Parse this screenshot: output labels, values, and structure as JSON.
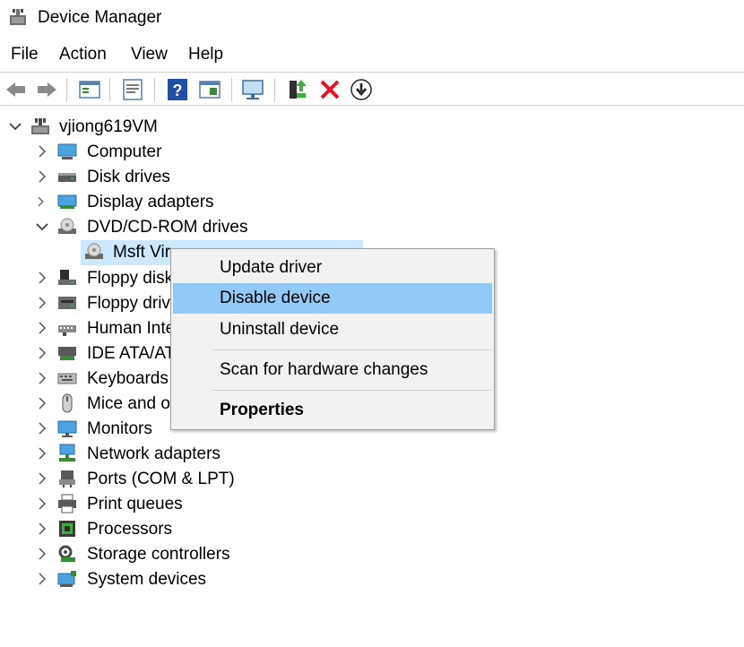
{
  "window": {
    "title": "Device Manager",
    "icon": "device-manager-icon"
  },
  "menu": [
    "File",
    "Action",
    "View",
    "Help"
  ],
  "toolbar": [
    "back-arrow-icon",
    "forward-arrow-icon",
    "show-hide-tree-icon",
    "properties-sheet-icon",
    "help-icon",
    "update-driver-view-icon",
    "monitor-scan-icon",
    "update-driver-icon",
    "uninstall-x-icon",
    "download-arrow-icon"
  ],
  "tree": {
    "root": {
      "label": "vjiong619VM",
      "expanded": true
    },
    "categories": [
      {
        "label": "Computer",
        "icon": "computer-icon"
      },
      {
        "label": "Disk drives",
        "icon": "disk-drive-icon"
      },
      {
        "label": "Display adapters",
        "icon": "display-adapter-icon"
      },
      {
        "label": "DVD/CD-ROM drives",
        "icon": "dvd-drive-icon",
        "expanded": true
      },
      {
        "label": "Floppy disk",
        "icon": "floppy-disk-icon"
      },
      {
        "label": "Floppy driv",
        "icon": "floppy-drive-icon"
      },
      {
        "label": "Human Inte",
        "icon": "human-interface-icon"
      },
      {
        "label": "IDE ATA/AT",
        "icon": "ide-ata-icon"
      },
      {
        "label": "Keyboards",
        "icon": "keyboard-icon"
      },
      {
        "label": "Mice and o",
        "icon": "mouse-icon"
      },
      {
        "label": "Monitors",
        "icon": "monitor-icon"
      },
      {
        "label": "Network adapters",
        "icon": "network-adapter-icon"
      },
      {
        "label": "Ports (COM & LPT)",
        "icon": "port-icon"
      },
      {
        "label": "Print queues",
        "icon": "printer-icon"
      },
      {
        "label": "Processors",
        "icon": "processor-icon"
      },
      {
        "label": "Storage controllers",
        "icon": "storage-controller-icon"
      },
      {
        "label": "System devices",
        "icon": "system-devices-icon"
      }
    ],
    "selected_device": {
      "label": "Msft Vir",
      "icon": "dvd-device-icon"
    }
  },
  "context_menu": {
    "items": [
      "Update driver",
      "Disable device",
      "Uninstall device",
      "Scan for hardware changes",
      "Properties"
    ],
    "highlighted": "Disable device"
  },
  "colors": {
    "selection": "#cce8ff",
    "menu_highlight": "#91c9f7",
    "accent_red": "#e81123"
  }
}
